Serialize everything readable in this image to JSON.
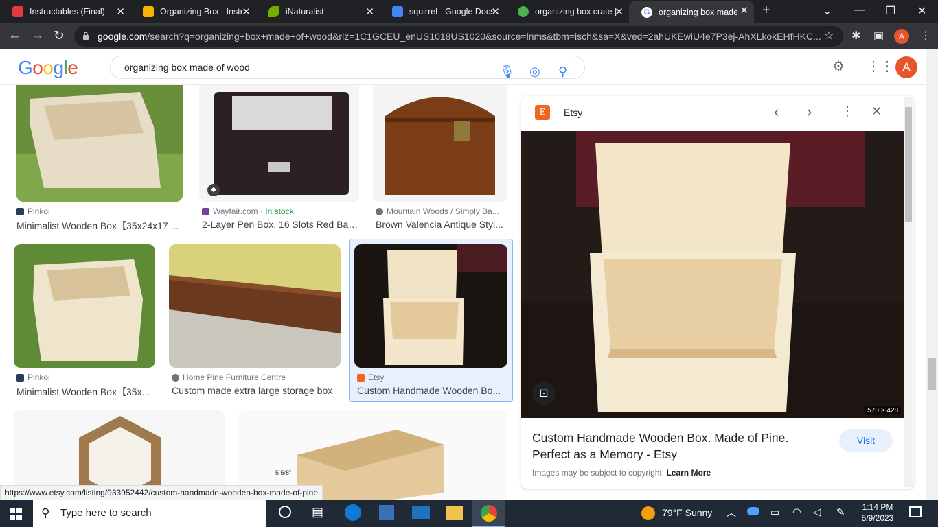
{
  "browser": {
    "tabs": [
      {
        "title": "Instructables (Final)",
        "fav_color": "#e03a3a"
      },
      {
        "title": "Organizing Box - Instr",
        "fav_color": "#f4b400"
      },
      {
        "title": "iNaturalist",
        "fav_color": "#74ac00"
      },
      {
        "title": "squirrel - Google Docs",
        "fav_color": "#4285f4"
      },
      {
        "title": "organizing box crate |",
        "fav_color": "#4caf50"
      },
      {
        "title": "organizing box made",
        "fav_color": "#ffffff"
      }
    ],
    "url_domain": "google.com",
    "url_rest": "/search?q=organizing+box+made+of+wood&rlz=1C1GCEU_enUS1018US1020&source=lnms&tbm=isch&sa=X&ved=2ahUKEwiU4e7P3ej-AhXLkokEHfHKC...",
    "profile_initial": "A"
  },
  "search": {
    "query": "organizing box made of wood",
    "logo": "Google"
  },
  "results": [
    {
      "source": "Pinkoi",
      "title": "Minimalist Wooden Box【35x24x17 ...",
      "stock": ""
    },
    {
      "source": "Wayfair.com",
      "stock": "In stock",
      "title": "2-Layer Pen Box, 16 Slots Red Bar..."
    },
    {
      "source": "Mountain Woods / Simply Ba...",
      "title": "Brown Valencia Antique Styl...",
      "stock": ""
    },
    {
      "source": "Pinkoi",
      "title": "Minimalist Wooden Box【35x...",
      "stock": ""
    },
    {
      "source": "Home Pine Furniture Centre",
      "title": "Custom made extra large storage box",
      "stock": ""
    },
    {
      "source": "Etsy",
      "title": "Custom Handmade Wooden Bo...",
      "stock": ""
    }
  ],
  "measure_label": "5 5/8\"",
  "panel": {
    "source": "Etsy",
    "favicon_letter": "E",
    "dimensions": "570 × 428",
    "title": "Custom Handmade Wooden Box. Made of Pine. Perfect as a Memory - Etsy",
    "visit_label": "Visit",
    "copyright": "Images may be subject to copyright.",
    "learn_more": "Learn More"
  },
  "status_url": "https://www.etsy.com/listing/933952442/custom-handmade-wooden-box-made-of-pine",
  "taskbar": {
    "search_placeholder": "Type here to search",
    "weather": "79°F  Sunny",
    "time": "1:14 PM",
    "date": "5/9/2023"
  },
  "colors": {
    "accent_blue": "#1a73e8",
    "selected_border": "#8ab4f8",
    "brand_orange": "#e8552d"
  }
}
